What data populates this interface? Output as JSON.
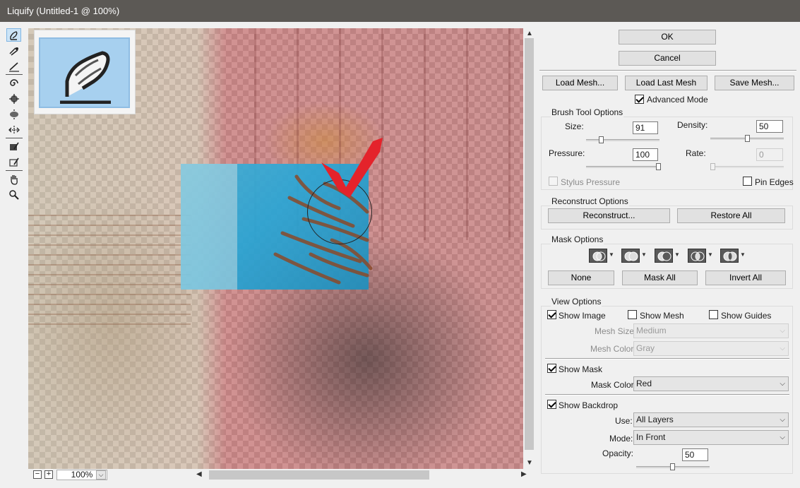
{
  "window": {
    "title": "Liquify (Untitled-1 @ 100%)"
  },
  "tools": [
    "forward-warp-icon",
    "reconstruct-icon",
    "smooth-icon",
    "twirl-icon",
    "pucker-icon",
    "bloat-icon",
    "push-left-icon",
    "freeze-mask-icon",
    "thaw-mask-icon",
    "hand-icon",
    "zoom-icon"
  ],
  "zoom": {
    "value": "100%"
  },
  "dialog": {
    "ok": "OK",
    "cancel": "Cancel"
  },
  "mesh": {
    "load": "Load Mesh...",
    "load_last": "Load Last Mesh",
    "save": "Save Mesh...",
    "advanced_mode": "Advanced Mode",
    "advanced_mode_checked": true
  },
  "brush": {
    "title": "Brush Tool Options",
    "size_label": "Size:",
    "size": "91",
    "density_label": "Density:",
    "density": "50",
    "pressure_label": "Pressure:",
    "pressure": "100",
    "rate_label": "Rate:",
    "rate": "0",
    "stylus_pressure": "Stylus Pressure",
    "pin_edges": "Pin Edges"
  },
  "reconstruct": {
    "title": "Reconstruct Options",
    "reconstruct_btn": "Reconstruct...",
    "restore_all": "Restore All"
  },
  "mask": {
    "title": "Mask Options",
    "modes": [
      "replace-selection-icon",
      "add-to-selection-icon",
      "subtract-from-selection-icon",
      "intersect-with-selection-icon",
      "invert-selection-icon"
    ],
    "none": "None",
    "mask_all": "Mask All",
    "invert_all": "Invert All"
  },
  "view": {
    "title": "View Options",
    "show_image": "Show Image",
    "show_image_checked": true,
    "show_mesh": "Show Mesh",
    "show_mesh_checked": false,
    "show_guides": "Show Guides",
    "show_guides_checked": false,
    "mesh_size_label": "Mesh Size:",
    "mesh_size": "Medium",
    "mesh_color_label": "Mesh Color:",
    "mesh_color": "Gray",
    "show_mask": "Show Mask",
    "show_mask_checked": true,
    "mask_color_label": "Mask Color:",
    "mask_color": "Red",
    "show_backdrop": "Show Backdrop",
    "show_backdrop_checked": true,
    "use_label": "Use:",
    "use": "All Layers",
    "mode_label": "Mode:",
    "mode": "In Front",
    "opacity_label": "Opacity:",
    "opacity": "50"
  }
}
